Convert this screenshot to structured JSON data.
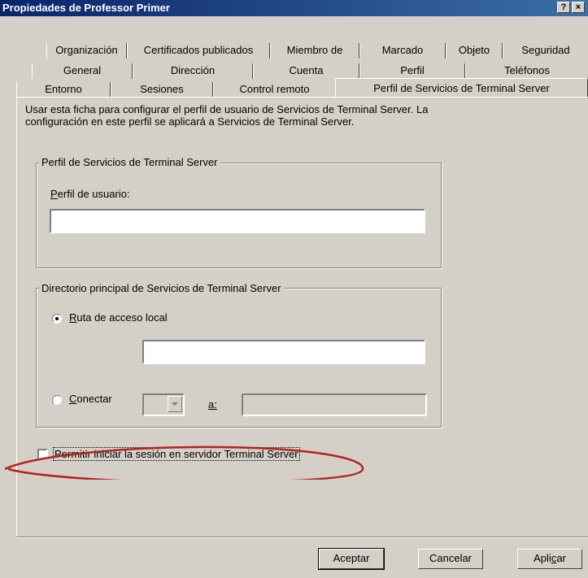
{
  "window": {
    "title": "Propiedades de Professor Primer",
    "help_btn": "?",
    "close_btn": "×"
  },
  "tabs_row1": [
    "Organización",
    "Certificados publicados",
    "Miembro de",
    "Marcado",
    "Objeto",
    "Seguridad"
  ],
  "tabs_row2": [
    "General",
    "Dirección",
    "Cuenta",
    "Perfil",
    "Teléfonos"
  ],
  "tabs_row3": [
    "Entorno",
    "Sesiones",
    "Control remoto"
  ],
  "active_tab": "Perfil de Servicios de Terminal Server",
  "description": "Usar esta ficha para configurar el perfil de usuario de Servicios de Terminal Server. La configuración en este perfil se aplicará a Servicios de Terminal Server.",
  "profile_group": {
    "title": "Perfil de Servicios de Terminal Server",
    "label_accel": "P",
    "label_rest": "erfil de usuario:",
    "value": ""
  },
  "home_group": {
    "title": "Directorio principal de Servicios de Terminal Server",
    "local_accel": "R",
    "local_rest": "uta de acceso local",
    "local_value": "",
    "connect_accel": "C",
    "connect_rest": "onectar",
    "to_label": "a:",
    "to_value": "",
    "local_selected": true
  },
  "allow_checkbox": {
    "label": "Permitir iniciar la sesión en servidor Terminal Server",
    "checked": false
  },
  "buttons": {
    "ok": "Aceptar",
    "cancel": "Cancelar",
    "apply_a": "Apli",
    "apply_b": "c",
    "apply_c": "ar"
  },
  "annotation_color": "#b22222"
}
